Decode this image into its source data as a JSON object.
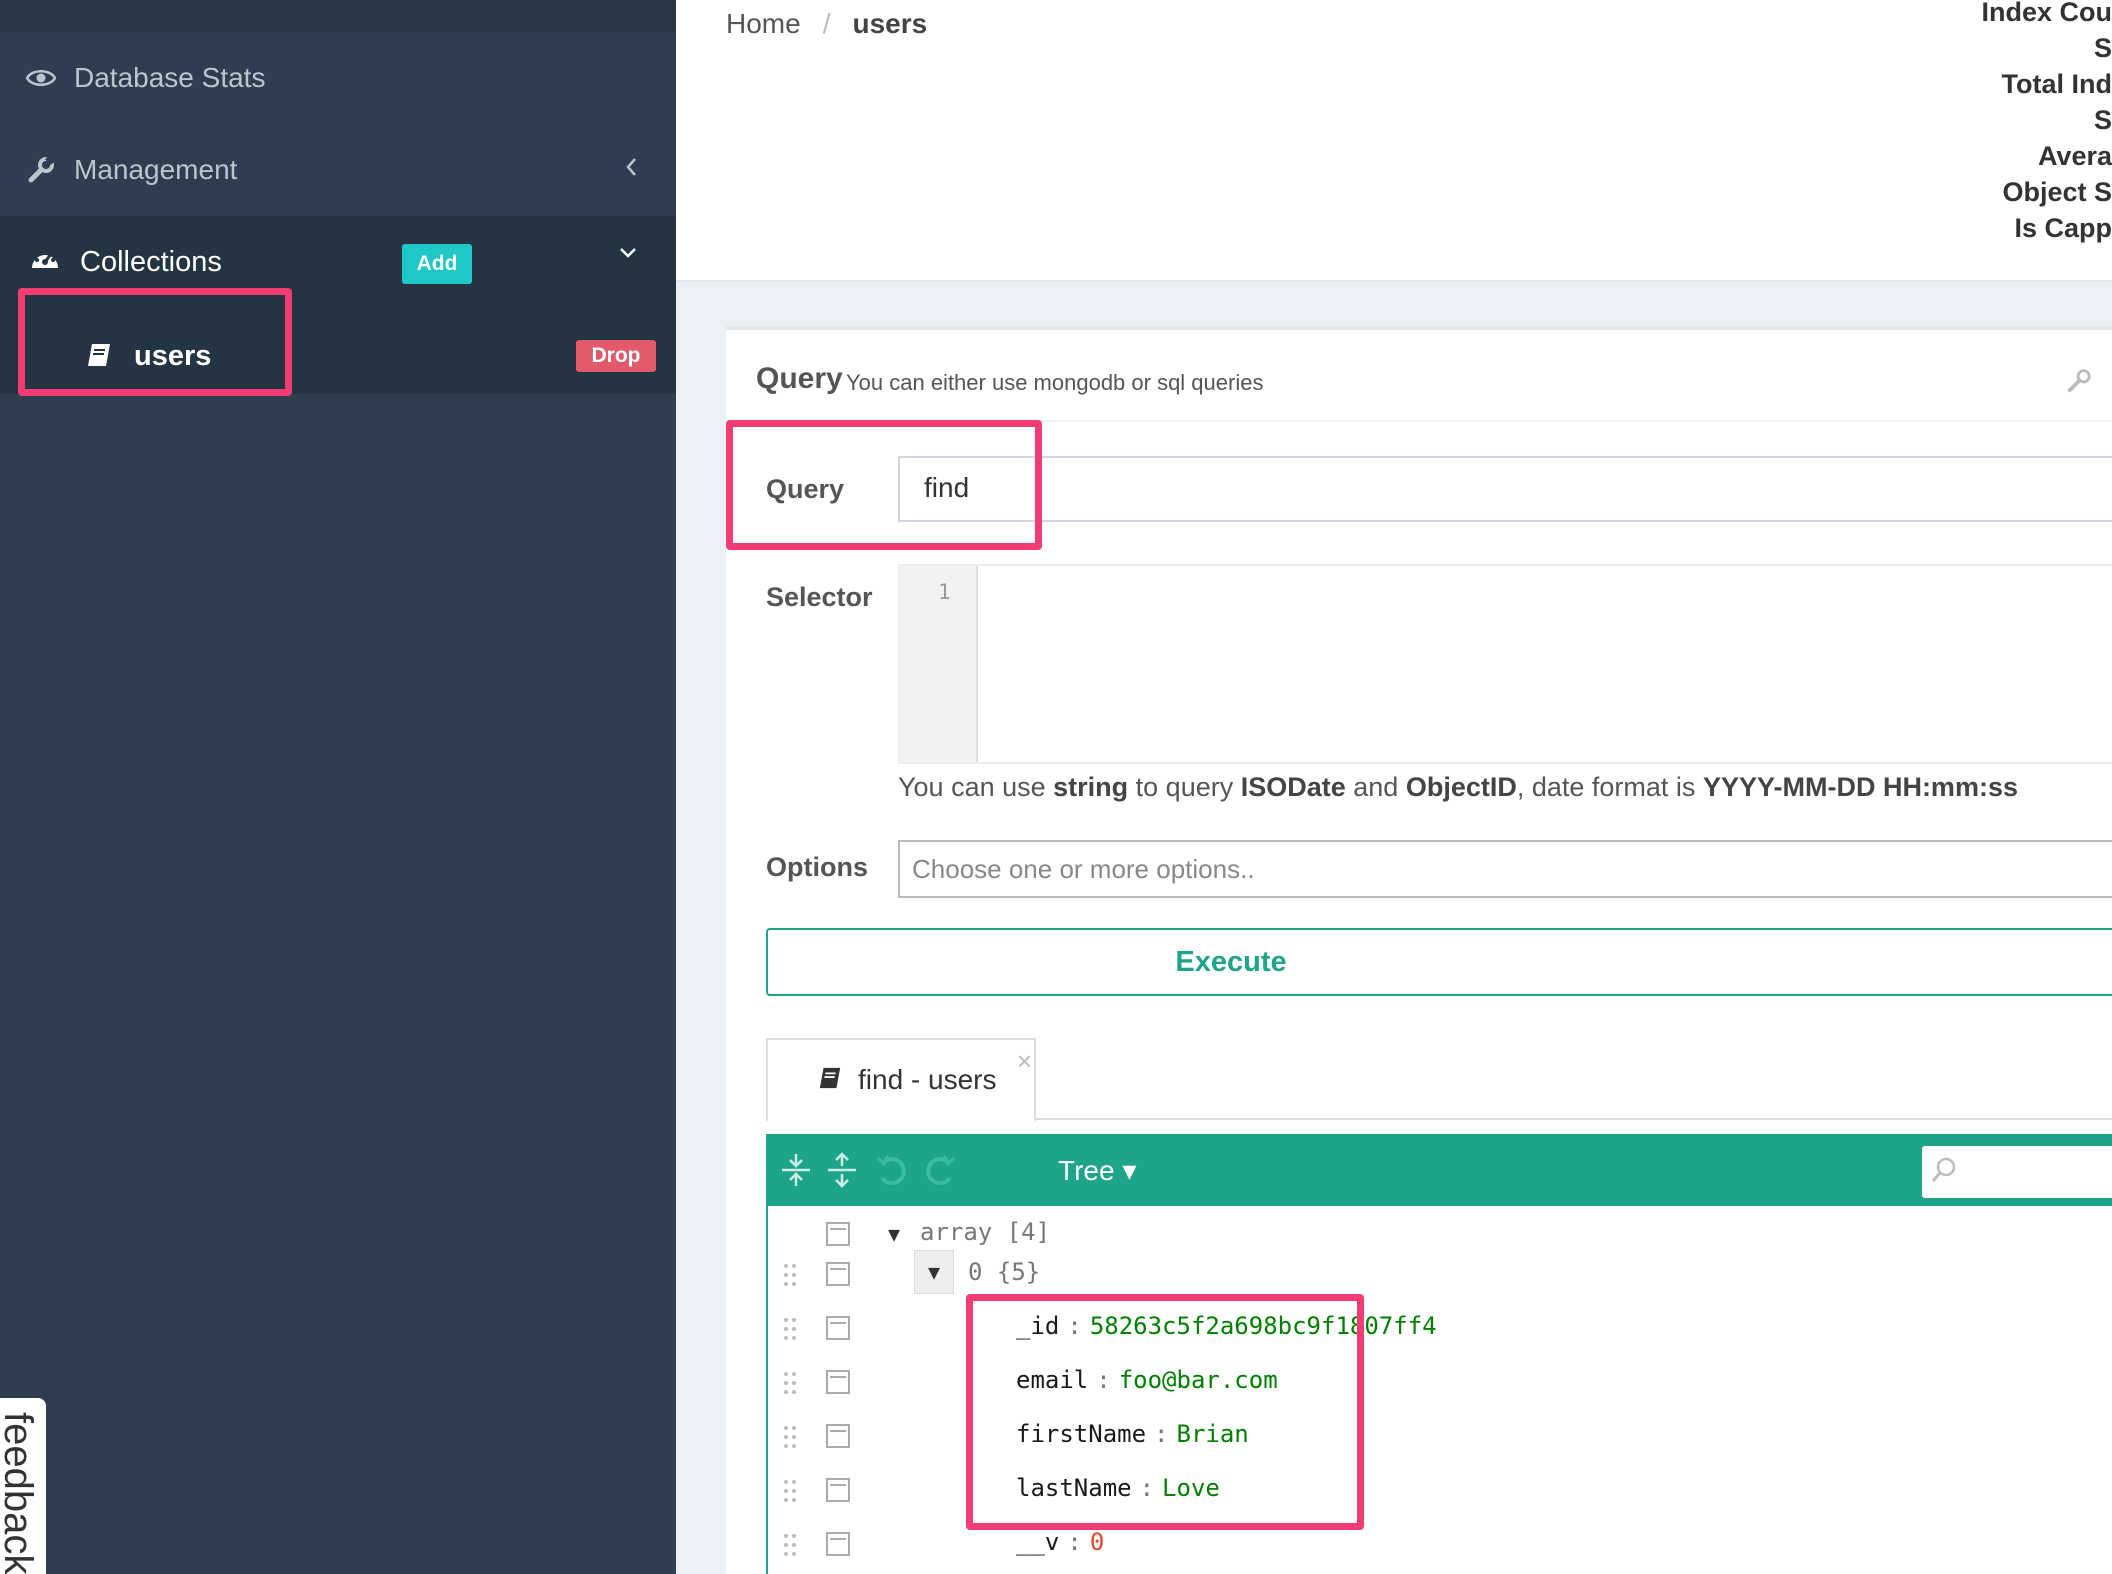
{
  "sidebar": {
    "database_stats": "Database Stats",
    "management": "Management",
    "collections": "Collections",
    "add_label": "Add",
    "collection_item": "users",
    "drop_label": "Drop",
    "feedback": "feedback"
  },
  "breadcrumb": {
    "home": "Home",
    "separator": "/",
    "current": "users"
  },
  "stats_labels": [
    "Index Cou",
    "S",
    "Total Ind",
    "S",
    "Avera",
    "Object S",
    "Is Capp"
  ],
  "query_panel": {
    "title": "Query",
    "subtitle": "You can either use mongodb or sql queries",
    "query_label": "Query",
    "query_value": "find",
    "selector_label": "Selector",
    "selector_line_number": "1",
    "help": {
      "p1": "You can use ",
      "b1": "string",
      "p2": " to query ",
      "b2": "ISODate",
      "p3": " and ",
      "b3": "ObjectID",
      "p4": ", date format is ",
      "b4": "YYYY-MM-DD HH:mm:ss"
    },
    "options_label": "Options",
    "options_placeholder": "Choose one or more options..",
    "execute_label": "Execute"
  },
  "result_tab": {
    "label": "find - users",
    "close": "×"
  },
  "json_editor": {
    "mode": "Tree",
    "mode_arrow": "▾",
    "root": {
      "key": "array",
      "count": "[4]"
    },
    "item0": {
      "key": "0",
      "count": "{5}"
    },
    "fields": [
      {
        "key": "_id",
        "value": "58263c5f2a698bc9f1807ff4",
        "kind": "string"
      },
      {
        "key": "email",
        "value": "foo@bar.com",
        "kind": "string"
      },
      {
        "key": "firstName",
        "value": "Brian",
        "kind": "string"
      },
      {
        "key": "lastName",
        "value": "Love",
        "kind": "string"
      },
      {
        "key": "__v",
        "value": "0",
        "kind": "number"
      }
    ],
    "colon": ":"
  },
  "colors": {
    "sidebar_bg": "#2e3e50",
    "accent_green": "#1ea589",
    "highlight": "#f33c74",
    "add_btn": "#1fc7c7",
    "drop_btn": "#e05a6b"
  },
  "icons": {
    "database_stats": "eye-icon",
    "management": "wrench-icon",
    "collections": "dashboard-icon",
    "collection_item": "book-icon",
    "expand_all": "expand-all-icon",
    "collapse_all": "collapse-all-icon",
    "undo": "undo-icon",
    "redo": "redo-icon",
    "search": "search-icon"
  }
}
